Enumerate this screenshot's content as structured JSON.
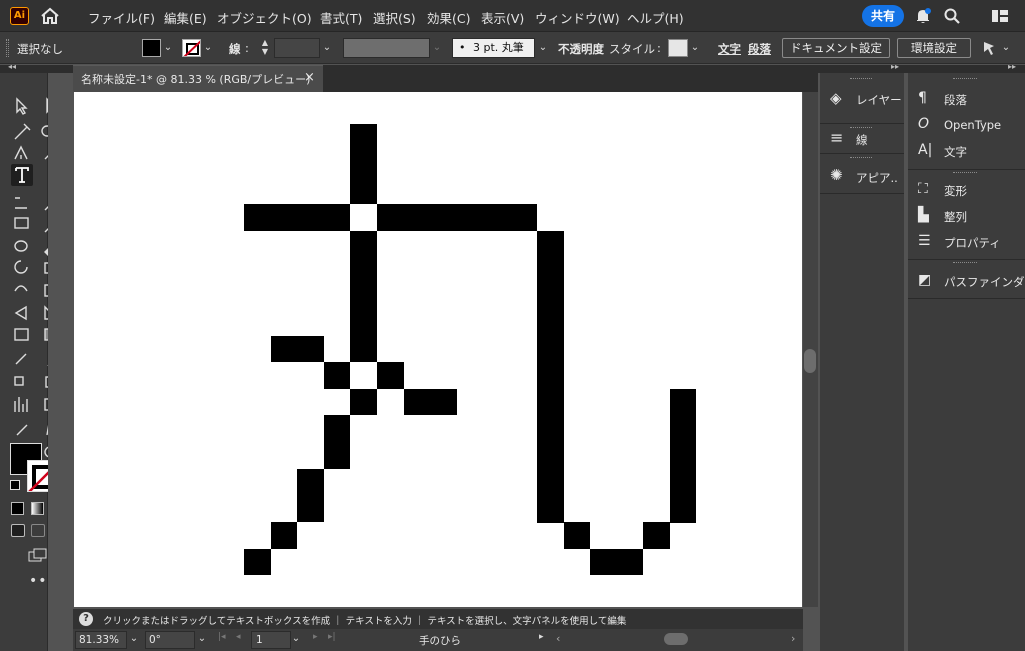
{
  "app": {
    "logo": "Ai"
  },
  "menu": [
    "ファイル(F)",
    "編集(E)",
    "オブジェクト(O)",
    "書式(T)",
    "選択(S)",
    "効果(C)",
    "表示(V)",
    "ウィンドウ(W)",
    "ヘルプ(H)"
  ],
  "share_label": "共有",
  "control_bar": {
    "selection": "選択なし",
    "stroke_label": "線",
    "brush": "3 pt. 丸筆",
    "brush_dot": "•",
    "opacity_label": "不透明度",
    "style_label": "スタイル",
    "char_label": "文字",
    "para_label": "段落",
    "doc_setup": "ドキュメント設定",
    "prefs": "環境設定"
  },
  "collapse_glyph": "◂◂",
  "expand_glyph": "▸▸",
  "document_tab": {
    "title": "名称未設定-1* @ 81.33 % (RGB/プレビュー)",
    "close": "×"
  },
  "status": {
    "help": "?",
    "text": "クリックまたはドラッグしてテキストボックスを作成 ｜ テキストを入力 ｜ テキストを選択し、文字パネルを使用して編集"
  },
  "bottom": {
    "zoom": "81.33%",
    "rotation": "0°",
    "artboard": "1",
    "tool_name": "手のひら"
  },
  "panels_left": [
    {
      "label": "レイヤー",
      "icon": "layers-icon"
    },
    {
      "label": "線",
      "icon": "stroke-icon"
    },
    {
      "label": "アピア..",
      "icon": "appearance-icon"
    }
  ],
  "panels_right": [
    {
      "label": "段落",
      "icon": "paragraph-icon"
    },
    {
      "label": "OpenType",
      "icon": "opentype-icon"
    },
    {
      "label": "文字",
      "icon": "character-icon"
    },
    {
      "label": "変形",
      "icon": "transform-icon"
    },
    {
      "label": "整列",
      "icon": "align-icon"
    },
    {
      "label": "プロパティ",
      "icon": "properties-icon"
    },
    {
      "label": "パスファインダー",
      "icon": "pathfinder-icon"
    }
  ],
  "icon_glyphs": {
    "layers-icon": "◈",
    "stroke-icon": "≡",
    "appearance-icon": "✺",
    "paragraph-icon": "¶",
    "opentype-icon": "O",
    "character-icon": "A|",
    "transform-icon": "⛶",
    "align-icon": "▙",
    "properties-icon": "☰",
    "pathfinder-icon": "◩"
  },
  "colors": {
    "accent": "#1473e6",
    "fill": "#000000",
    "stroke_none_slash": "#d0021b",
    "artboard": "#ffffff",
    "workspace": "#535353"
  },
  "artwork": {
    "pixel_char": "丸"
  }
}
